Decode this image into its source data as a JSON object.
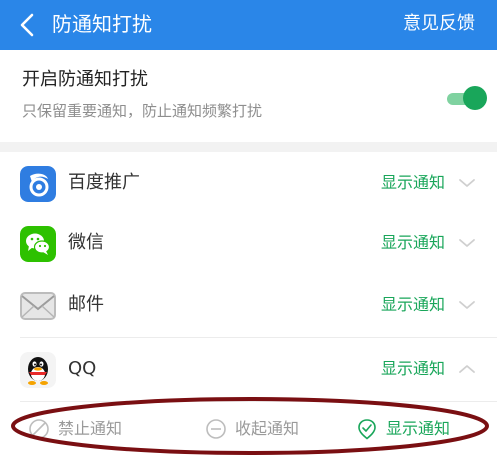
{
  "header": {
    "title": "防通知打扰",
    "feedback": "意见反馈",
    "bg_color": "#2a86e8"
  },
  "toggle": {
    "title": "开启防通知打扰",
    "subtitle": "只保留重要通知，防止通知频繁打扰",
    "enabled": true,
    "accent": "#19a65a"
  },
  "apps": [
    {
      "name": "百度推广",
      "status": "显示通知",
      "icon": "baidu-promotion-icon",
      "expanded": false
    },
    {
      "name": "微信",
      "status": "显示通知",
      "icon": "wechat-icon",
      "expanded": false
    },
    {
      "name": "邮件",
      "status": "显示通知",
      "icon": "mail-icon",
      "expanded": false
    },
    {
      "name": "QQ",
      "status": "显示通知",
      "icon": "qq-icon",
      "expanded": true
    }
  ],
  "options": [
    {
      "label": "禁止通知",
      "icon": "ban-icon",
      "state": "disabled"
    },
    {
      "label": "收起通知",
      "icon": "collapse-icon",
      "state": "disabled"
    },
    {
      "label": "显示通知",
      "icon": "notify-check-icon",
      "state": "selected"
    }
  ],
  "annotation_color": "#7a0f12"
}
